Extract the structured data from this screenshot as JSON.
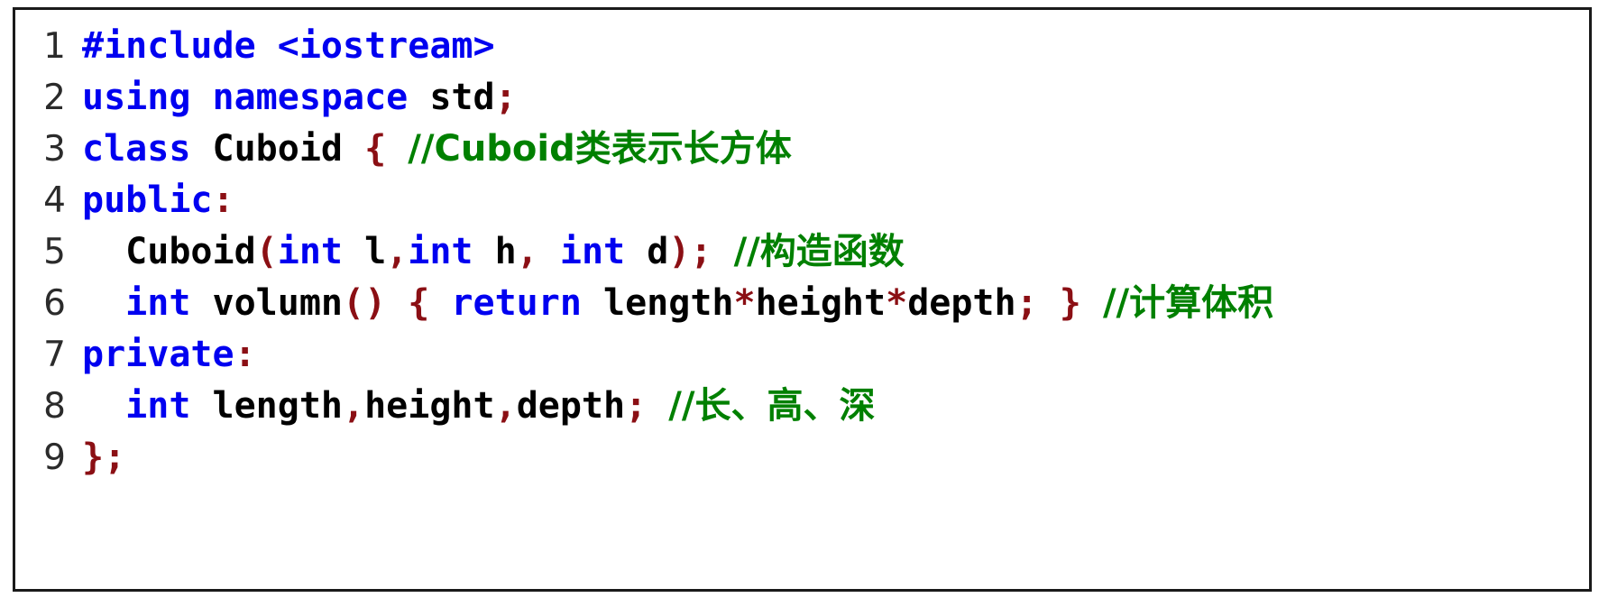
{
  "listing": {
    "language": "C++",
    "colors": {
      "keyword": "#0000f0",
      "identifier": "#000000",
      "punctuation": "#8b0f14",
      "comment": "#008000",
      "line_number": "#2b2b2b",
      "border": "#1a1a1a",
      "background": "#ffffff"
    },
    "lines": [
      {
        "number": "1",
        "text": "#include <iostream>",
        "tokens": [
          {
            "t": "#include <iostream>",
            "c": "pre"
          }
        ]
      },
      {
        "number": "2",
        "text": "using namespace std;",
        "tokens": [
          {
            "t": "using namespace ",
            "c": "kw"
          },
          {
            "t": "std",
            "c": "id"
          },
          {
            "t": ";",
            "c": "punc"
          }
        ]
      },
      {
        "number": "3",
        "text": "class Cuboid { //Cuboid类表示长方体",
        "tokens": [
          {
            "t": "class ",
            "c": "kw"
          },
          {
            "t": "Cuboid ",
            "c": "id"
          },
          {
            "t": "{ ",
            "c": "punc"
          },
          {
            "t": "//Cuboid类表示长方体",
            "c": "cmt"
          }
        ]
      },
      {
        "number": "4",
        "text": "public:",
        "tokens": [
          {
            "t": "public",
            "c": "kw"
          },
          {
            "t": ":",
            "c": "punc"
          }
        ]
      },
      {
        "number": "5",
        "text": "  Cuboid(int l,int h, int d); //构造函数",
        "tokens": [
          {
            "t": "  Cuboid",
            "c": "id"
          },
          {
            "t": "(",
            "c": "punc"
          },
          {
            "t": "int",
            "c": "kw"
          },
          {
            "t": " l",
            "c": "id"
          },
          {
            "t": ",",
            "c": "punc"
          },
          {
            "t": "int",
            "c": "kw"
          },
          {
            "t": " h",
            "c": "id"
          },
          {
            "t": ",",
            "c": "punc"
          },
          {
            "t": " ",
            "c": "id"
          },
          {
            "t": "int",
            "c": "kw"
          },
          {
            "t": " d",
            "c": "id"
          },
          {
            "t": ");",
            "c": "punc"
          },
          {
            "t": " ",
            "c": "id"
          },
          {
            "t": "//构造函数",
            "c": "cmt"
          }
        ]
      },
      {
        "number": "6",
        "text": "  int volumn() { return length*height*depth; } //计算体积",
        "tokens": [
          {
            "t": "  ",
            "c": "id"
          },
          {
            "t": "int",
            "c": "kw"
          },
          {
            "t": " volumn",
            "c": "id"
          },
          {
            "t": "() { ",
            "c": "punc"
          },
          {
            "t": "return",
            "c": "kw"
          },
          {
            "t": " length",
            "c": "id"
          },
          {
            "t": "*",
            "c": "punc"
          },
          {
            "t": "height",
            "c": "id"
          },
          {
            "t": "*",
            "c": "punc"
          },
          {
            "t": "depth",
            "c": "id"
          },
          {
            "t": "; } ",
            "c": "punc"
          },
          {
            "t": "//计算体积",
            "c": "cmt"
          }
        ]
      },
      {
        "number": "7",
        "text": "private:",
        "tokens": [
          {
            "t": "private",
            "c": "kw"
          },
          {
            "t": ":",
            "c": "punc"
          }
        ]
      },
      {
        "number": "8",
        "text": "  int length,height,depth; //长、高、深",
        "tokens": [
          {
            "t": "  ",
            "c": "id"
          },
          {
            "t": "int",
            "c": "kw"
          },
          {
            "t": " length",
            "c": "id"
          },
          {
            "t": ",",
            "c": "punc"
          },
          {
            "t": "height",
            "c": "id"
          },
          {
            "t": ",",
            "c": "punc"
          },
          {
            "t": "depth",
            "c": "id"
          },
          {
            "t": ";",
            "c": "punc"
          },
          {
            "t": " ",
            "c": "id"
          },
          {
            "t": "//长、高、深",
            "c": "cmt"
          }
        ]
      },
      {
        "number": "9",
        "text": "};",
        "tokens": [
          {
            "t": "};",
            "c": "punc"
          }
        ]
      }
    ]
  }
}
